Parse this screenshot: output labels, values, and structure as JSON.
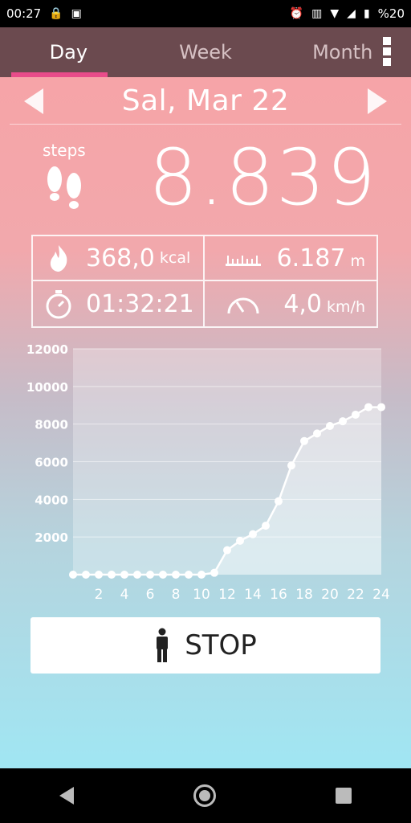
{
  "status_bar": {
    "time": "00:27",
    "battery": "%20"
  },
  "tabs": [
    {
      "label": "Day",
      "active": true
    },
    {
      "label": "Week",
      "active": false
    },
    {
      "label": "Month",
      "active": false
    }
  ],
  "date_label": "Sal, Mar 22",
  "steps": {
    "label": "steps",
    "value": "8.839"
  },
  "stats": {
    "calories": {
      "value": "368,0",
      "unit": "kcal"
    },
    "distance": {
      "value": "6.187",
      "unit": "m"
    },
    "duration": {
      "value": "01:32:21"
    },
    "speed": {
      "value": "4,0",
      "unit": "km/h"
    }
  },
  "stop_button": {
    "label": "STOP"
  },
  "colors": {
    "tab_indicator": "#e84c8a",
    "tab_bar": "#6b4a4f"
  },
  "chart_data": {
    "type": "area",
    "x": [
      0,
      1,
      2,
      3,
      4,
      5,
      6,
      7,
      8,
      9,
      10,
      11,
      12,
      13,
      14,
      15,
      16,
      17,
      18,
      19,
      20,
      21,
      22,
      23,
      24
    ],
    "values": [
      0,
      0,
      0,
      0,
      0,
      0,
      0,
      0,
      0,
      0,
      0,
      100,
      1300,
      1800,
      2150,
      2600,
      3900,
      5800,
      7100,
      7500,
      7900,
      8150,
      8500,
      8900,
      8900
    ],
    "x_tick_labels": [
      "2",
      "4",
      "6",
      "8",
      "10",
      "12",
      "14",
      "16",
      "18",
      "20",
      "22",
      "24"
    ],
    "y_tick_labels": [
      "2000",
      "4000",
      "6000",
      "8000",
      "10000",
      "12000"
    ],
    "ylim": [
      0,
      12000
    ],
    "xlim": [
      0,
      24
    ],
    "grid": true
  }
}
